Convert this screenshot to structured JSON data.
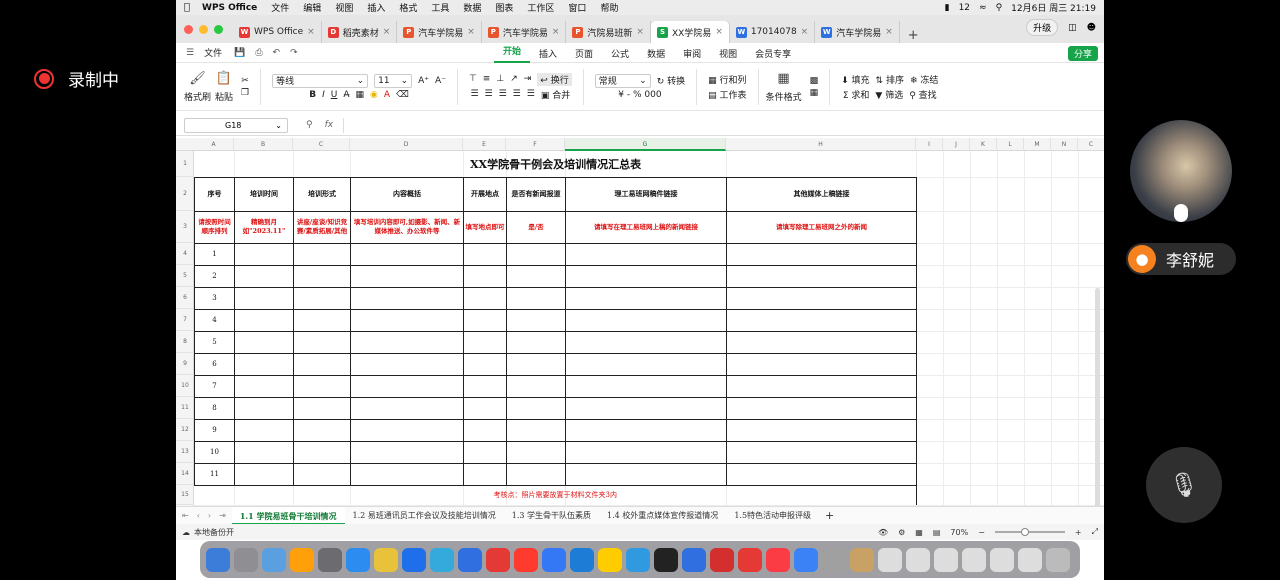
{
  "recording": {
    "label": "录制中"
  },
  "participant": {
    "name": "李舒妮"
  },
  "macos_menu": {
    "app": "WPS Office",
    "items": [
      "文件",
      "编辑",
      "视图",
      "插入",
      "格式",
      "工具",
      "数据",
      "图表",
      "工作区",
      "窗口",
      "帮助"
    ],
    "battery": "12",
    "clock": "12月6日 周三  21:19"
  },
  "tabs": [
    {
      "label": "WPS Office",
      "icon": "W",
      "color": "#e53935"
    },
    {
      "label": "稻壳素材",
      "icon": "D",
      "color": "#e53935"
    },
    {
      "label": "汽车学院易",
      "icon": "P",
      "color": "#e8542e"
    },
    {
      "label": "汽车学院易",
      "icon": "P",
      "color": "#e8542e"
    },
    {
      "label": "汽院易班新",
      "icon": "P",
      "color": "#e8542e"
    },
    {
      "label": "XX学院易",
      "icon": "S",
      "color": "#16a34a",
      "active": true
    },
    {
      "label": "17014078",
      "icon": "W",
      "color": "#2f6fe0"
    },
    {
      "label": "汽车学院易",
      "icon": "W",
      "color": "#2f6fe0"
    }
  ],
  "upgrade_label": "升级",
  "menubar": {
    "file": "文件",
    "tabs": [
      "开始",
      "插入",
      "页面",
      "公式",
      "数据",
      "审阅",
      "视图",
      "会员专享"
    ],
    "active": "开始",
    "share": "分享"
  },
  "ribbon": {
    "format_painter": "格式刷",
    "paste": "粘贴",
    "font": "等线",
    "font_size": "11",
    "wrap": "换行",
    "number_format": "常规",
    "convert": "转换",
    "rows_cols": "行和列",
    "worksheet": "工作表",
    "merge": "合并",
    "cond_format": "条件格式",
    "fill": "填充",
    "sort": "排序",
    "freeze": "冻结",
    "sum": "求和",
    "filter": "筛选",
    "find": "查找",
    "percent_symbols": "¥ - %  000"
  },
  "formula_bar": {
    "cell": "G18",
    "fx": "fx"
  },
  "columns": [
    "A",
    "B",
    "C",
    "D",
    "E",
    "F",
    "G",
    "H",
    "I",
    "J",
    "K",
    "L",
    "M",
    "N",
    "C"
  ],
  "rows": [
    "1",
    "2",
    "3",
    "4",
    "5",
    "6",
    "7",
    "8",
    "9",
    "10",
    "11",
    "12",
    "13",
    "14",
    "15"
  ],
  "sheet": {
    "title": "XX学院骨干例会及培训情况汇总表",
    "headers": [
      "序号",
      "培训时间",
      "培训形式",
      "内容概括",
      "开展地点",
      "是否有新闻报道",
      "理工易班网稿件链接",
      "其他媒体上稿链接"
    ],
    "instructions": [
      "请按照时间顺序排列",
      "精确到月 如\"2023.11\"",
      "讲座/座谈/知识竞赛/素质拓展/其他",
      "填写培训内容即可,如摄影、新闻、新媒体推送、办公软件等",
      "填写地点即可",
      "是/否",
      "请填写在理工易班网上稿的新闻链接",
      "请填写除理工易班网之外的新闻"
    ],
    "numbers": [
      "1",
      "2",
      "3",
      "4",
      "5",
      "6",
      "7",
      "8",
      "9",
      "10",
      "11"
    ],
    "note": "考核点：照片需要放置于材料文件夹3内"
  },
  "sheet_tabs": [
    "1.1 学院易班骨干培训情况",
    "1.2 易班通讯员工作会议及技能培训情况",
    "1.3 学生骨干队伍素质",
    "1.4 校外重点媒体宣传报道情况",
    "1.5特色活动申报评级"
  ],
  "status": {
    "backup": "本地备份开",
    "zoom": "70%"
  }
}
